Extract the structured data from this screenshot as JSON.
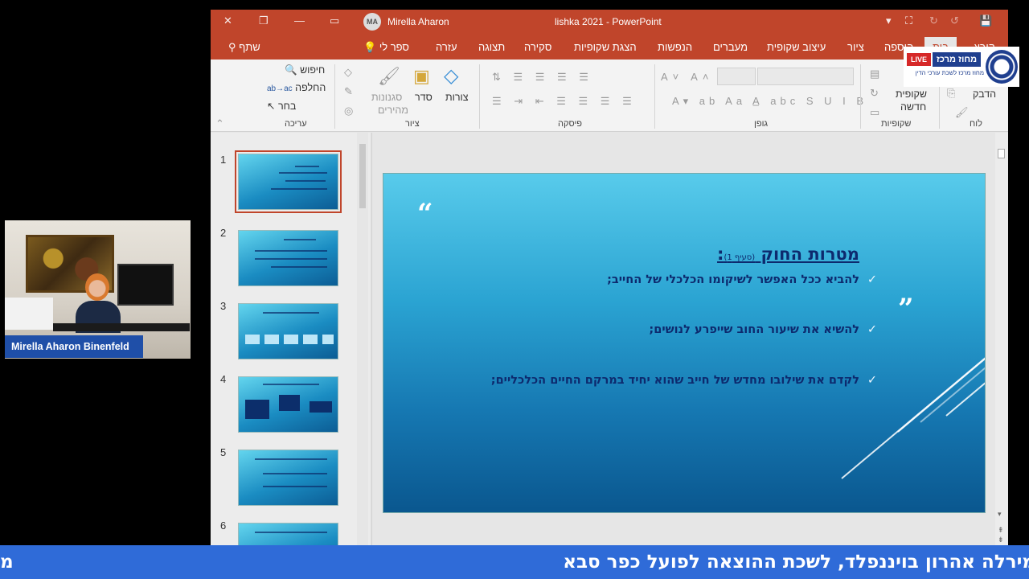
{
  "webcam": {
    "participant_name": "Mirella Aharon Binenfeld"
  },
  "window": {
    "user_initials": "MA",
    "user_name": "Mirella Aharon",
    "doc_title": "lishka 2021  -  PowerPoint",
    "close_glyph": "✕",
    "restore_glyph": "❐",
    "minimize_glyph": "—",
    "save_glyph": "💾"
  },
  "tabs": {
    "share": "שתף",
    "tell_me": "ספר לי",
    "help": "עזרה",
    "view": "תצוגה",
    "review": "סקירה",
    "slideshow": "הצגת שקופיות",
    "animations": "הנפשות",
    "transitions": "מעברים",
    "design": "עיצוב שקופית",
    "draw": "ציור",
    "insert": "הוספה",
    "home": "בית",
    "file": "קובץ"
  },
  "ribbon": {
    "find": "חיפוש",
    "replace": "החלפה",
    "select": "בחר",
    "editing_group": "עריכה",
    "styles": "סגנונות",
    "styles2": "מהירים",
    "arrange": "סדר",
    "shapes": "צורות",
    "drawing_group": "ציור",
    "paragraph_group": "פיסקה",
    "font_group": "גופן",
    "new_slide": "שקופית",
    "new_slide2": "חדשה",
    "slides_group": "שקופיות",
    "paste": "הדבק",
    "clipboard_group": "לוח"
  },
  "thumbnails": [
    "1",
    "2",
    "3",
    "4",
    "5",
    "6"
  ],
  "slide": {
    "title": "מטרות החוק",
    "title_ref": "(סעיף 1)",
    "title_colon": ":",
    "bullets": [
      "להביא ככל האפשר לשיקומו הכלכלי של החייב;",
      "להשיא את שיעור החוב שייפרע לנושים;",
      "לקדם את שילובו מחדש של חייב שהוא יחיד במרקם החיים הכלכליים;"
    ],
    "check_glyph": "✓",
    "open_quote": "“",
    "close_quote": "”"
  },
  "ticker": {
    "left_fragment": "מ",
    "text": "מירלה אהרון בויננפלד, לשכת ההוצאה לפועל כפר סבא"
  },
  "logo": {
    "live": "LIVE",
    "name": "מחוז מרכז",
    "subtitle": "מחוז מרכז לשכת עורכי הדין"
  }
}
